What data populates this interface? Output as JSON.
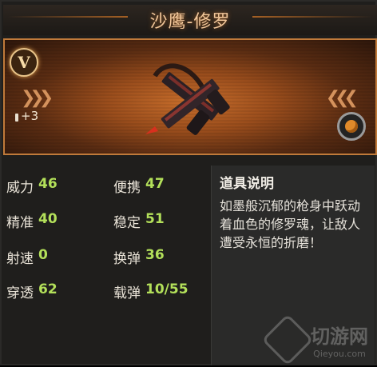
{
  "header": {
    "title": "沙鹰-修罗"
  },
  "display": {
    "rank_badge": "V",
    "ammo_bonus": "+3",
    "icons": [
      "v-rank-icon",
      "ammo-icon",
      "left-chevrons-icon",
      "right-chevrons-icon",
      "switch-icon",
      "pistol-icon"
    ]
  },
  "stats": [
    {
      "label": "威力",
      "value": "46"
    },
    {
      "label": "便携",
      "value": "47"
    },
    {
      "label": "精准",
      "value": "40"
    },
    {
      "label": "稳定",
      "value": "51"
    },
    {
      "label": "射速",
      "value": "0"
    },
    {
      "label": "换弹",
      "value": "36"
    },
    {
      "label": "穿透",
      "value": "62"
    },
    {
      "label": "载弹",
      "value": "10/55"
    }
  ],
  "description": {
    "title": "道具说明",
    "body": "如墨般沉郁的枪身中跃动着血色的修罗魂，让敌人遭受永恒的折磨！"
  },
  "watermark": {
    "name": "切游网",
    "url": "Qieyou.com"
  },
  "colors": {
    "accent": "#c07a3a",
    "value_green": "#b3e05a",
    "title": "#f2c79a"
  }
}
